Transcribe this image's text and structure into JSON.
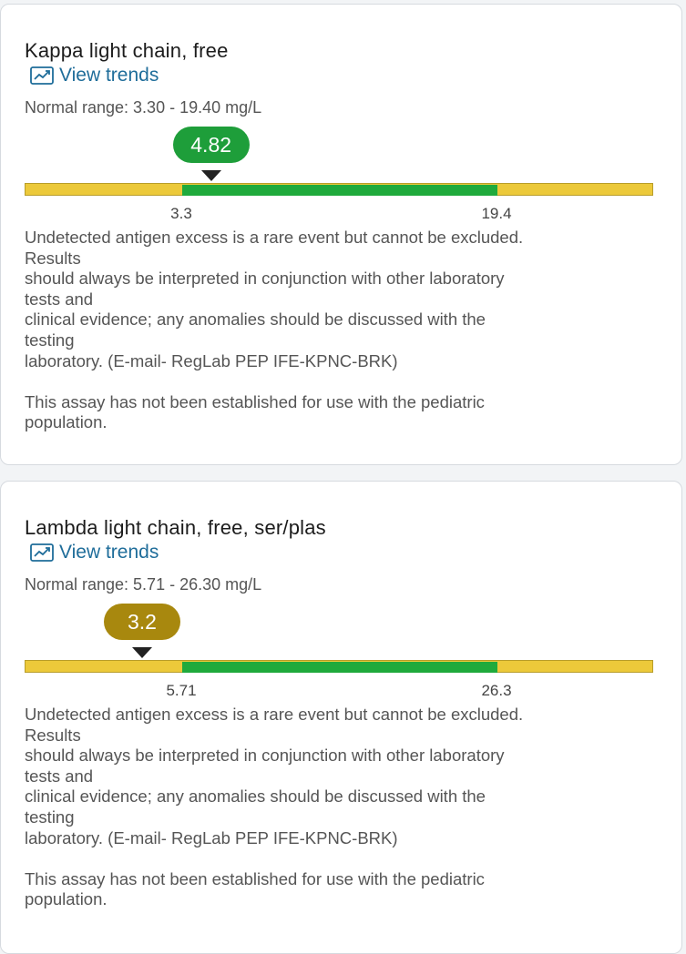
{
  "colors": {
    "normal_band": "#1faa3c",
    "out_of_range_band": "#ecc93a",
    "in_range_value": "#1e9e3a",
    "out_of_range_value": "#a8880e",
    "link": "#1f6d9a"
  },
  "results": [
    {
      "title": "Kappa light chain, free",
      "view_trends_label": "View trends",
      "trend_icon": "line-chart-icon",
      "normal_range": "Normal range: 3.30 - 19.40 mg/L",
      "value_label": "4.82",
      "value": 4.82,
      "low": 3.3,
      "high": 19.4,
      "low_label": "3.3",
      "high_label": "19.4",
      "status": "normal",
      "note_lines": [
        "Undetected antigen excess is a rare event but cannot be excluded.",
        "Results",
        "should always be interpreted in conjunction with other laboratory",
        "tests and",
        "clinical evidence; any anomalies should be discussed with the",
        "testing",
        "laboratory. (E-mail- RegLab PEP IFE-KPNC-BRK)"
      ],
      "pediatric_note_lines": [
        "This assay has not been established for use with the pediatric",
        "population."
      ]
    },
    {
      "title": "Lambda light chain, free, ser/plas",
      "view_trends_label": "View trends",
      "trend_icon": "line-chart-icon",
      "normal_range": "Normal range: 5.71 - 26.30 mg/L",
      "value_label": "3.2",
      "value": 3.2,
      "low": 5.71,
      "high": 26.3,
      "low_label": "5.71",
      "high_label": "26.3",
      "status": "low",
      "note_lines": [
        "Undetected antigen excess is a rare event but cannot be excluded.",
        "Results",
        "should always be interpreted in conjunction with other laboratory",
        "tests and",
        "clinical evidence; any anomalies should be discussed with the",
        "testing",
        "laboratory. (E-mail- RegLab PEP IFE-KPNC-BRK)"
      ],
      "pediatric_note_lines": [
        "This assay has not been established for use with the pediatric",
        "population."
      ]
    }
  ]
}
